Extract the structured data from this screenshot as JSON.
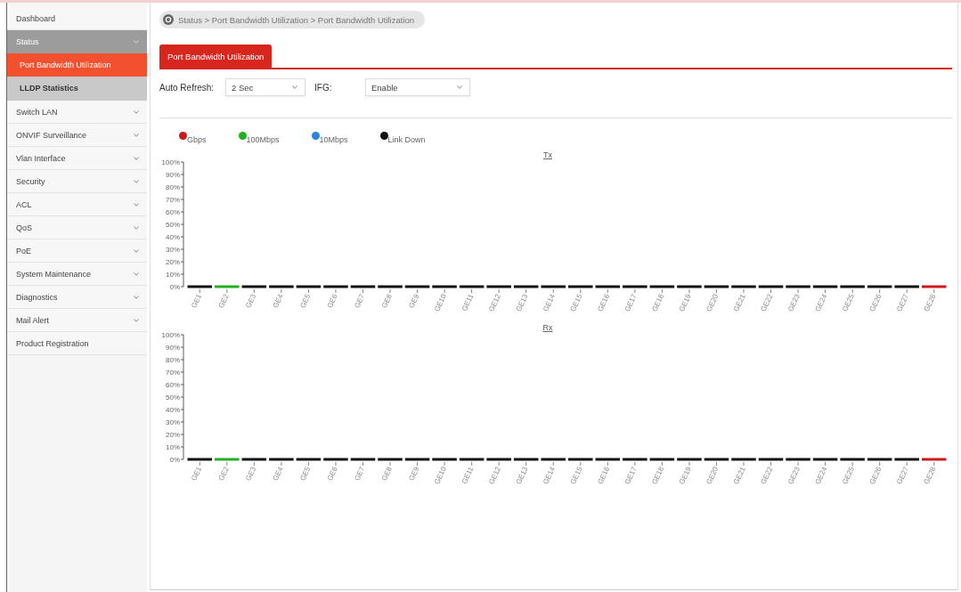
{
  "sidebar": {
    "items": [
      {
        "kind": "link",
        "label": "Dashboard"
      },
      {
        "kind": "group",
        "label": "Status",
        "expanded": true,
        "children": [
          {
            "label": "Port Bandwidth Utilization",
            "selected": true
          },
          {
            "label": "LLDP Statistics",
            "selected": false
          }
        ]
      },
      {
        "kind": "group",
        "label": "Switch LAN",
        "expanded": false
      },
      {
        "kind": "group",
        "label": "ONVIF Surveillance",
        "expanded": false
      },
      {
        "kind": "group",
        "label": "Vlan Interface",
        "expanded": false
      },
      {
        "kind": "group",
        "label": "Security",
        "expanded": false
      },
      {
        "kind": "group",
        "label": "ACL",
        "expanded": false
      },
      {
        "kind": "group",
        "label": "QoS",
        "expanded": false
      },
      {
        "kind": "group",
        "label": "PoE",
        "expanded": false
      },
      {
        "kind": "group",
        "label": "System Maintenance",
        "expanded": false
      },
      {
        "kind": "group",
        "label": "Diagnostics",
        "expanded": false
      },
      {
        "kind": "group",
        "label": "Mail Alert",
        "expanded": false
      },
      {
        "kind": "link",
        "label": "Product Registration"
      }
    ]
  },
  "breadcrumb": {
    "text": "Status > Port Bandwidth Utilization > Port Bandwidth Utilization"
  },
  "tabs": [
    {
      "label": "Port Bandwidth Utilization",
      "selected": true
    }
  ],
  "controls": [
    {
      "label": "Auto Refresh:",
      "value": "2 Sec"
    },
    {
      "label": "IFG:",
      "value": "Enable"
    }
  ],
  "charts": [
    {
      "chart_data": {
        "type": "bar",
        "title": "Tx",
        "categories": [
          "GE1",
          "GE2",
          "GE3",
          "GE4",
          "GE5",
          "GE6",
          "GE7",
          "GE8",
          "GE9",
          "GE10",
          "GE11",
          "GE12",
          "GE13",
          "GE14",
          "GE15",
          "GE16",
          "GE17",
          "GE18",
          "GE19",
          "GE20",
          "GE21",
          "GE22",
          "GE23",
          "GE24",
          "GE25",
          "GE26",
          "GE27",
          "GE28"
        ],
        "ylim": [
          0,
          100
        ],
        "yticks": [
          {
            "value": 0,
            "label": "0%"
          },
          {
            "value": 10,
            "label": "10%"
          },
          {
            "value": 20,
            "label": "20%"
          },
          {
            "value": 30,
            "label": "30%"
          },
          {
            "value": 40,
            "label": "40%"
          },
          {
            "value": 50,
            "label": "50%"
          },
          {
            "value": 60,
            "label": "60%"
          },
          {
            "value": 70,
            "label": "70%"
          },
          {
            "value": 80,
            "label": "80%"
          },
          {
            "value": 90,
            "label": "90%"
          },
          {
            "value": 100,
            "label": "100%"
          }
        ],
        "series": [
          {
            "name": "Gbps",
            "color": "#cc1a1a",
            "values": [
              null,
              null,
              null,
              null,
              null,
              null,
              null,
              null,
              null,
              null,
              null,
              null,
              null,
              null,
              null,
              null,
              null,
              null,
              null,
              null,
              null,
              null,
              null,
              null,
              null,
              null,
              null,
              0
            ]
          },
          {
            "name": "100Mbps",
            "color": "#22b022",
            "values": [
              null,
              0,
              null,
              null,
              null,
              null,
              null,
              null,
              null,
              null,
              null,
              null,
              null,
              null,
              null,
              null,
              null,
              null,
              null,
              null,
              null,
              null,
              null,
              null,
              null,
              null,
              null,
              null
            ]
          },
          {
            "name": "10Mbps",
            "color": "#2b86d8",
            "values": [
              null,
              null,
              null,
              null,
              null,
              null,
              null,
              null,
              null,
              null,
              null,
              null,
              null,
              null,
              null,
              null,
              null,
              null,
              null,
              null,
              null,
              null,
              null,
              null,
              null,
              null,
              null,
              null
            ]
          },
          {
            "name": "Link Down",
            "color": "#111111",
            "values": [
              0,
              null,
              0,
              0,
              0,
              0,
              0,
              0,
              0,
              0,
              0,
              0,
              0,
              0,
              0,
              0,
              0,
              0,
              0,
              0,
              0,
              0,
              0,
              0,
              0,
              0,
              0,
              null
            ]
          }
        ]
      }
    },
    {
      "chart_data": {
        "type": "bar",
        "title": "Rx",
        "categories": [
          "GE1",
          "GE2",
          "GE3",
          "GE4",
          "GE5",
          "GE6",
          "GE7",
          "GE8",
          "GE9",
          "GE10",
          "GE11",
          "GE12",
          "GE13",
          "GE14",
          "GE15",
          "GE16",
          "GE17",
          "GE18",
          "GE19",
          "GE20",
          "GE21",
          "GE22",
          "GE23",
          "GE24",
          "GE25",
          "GE26",
          "GE27",
          "GE28"
        ],
        "ylim": [
          0,
          100
        ],
        "yticks": [
          {
            "value": 0,
            "label": "0%"
          },
          {
            "value": 10,
            "label": "10%"
          },
          {
            "value": 20,
            "label": "20%"
          },
          {
            "value": 30,
            "label": "30%"
          },
          {
            "value": 40,
            "label": "40%"
          },
          {
            "value": 50,
            "label": "50%"
          },
          {
            "value": 60,
            "label": "60%"
          },
          {
            "value": 70,
            "label": "70%"
          },
          {
            "value": 80,
            "label": "80%"
          },
          {
            "value": 90,
            "label": "90%"
          },
          {
            "value": 100,
            "label": "100%"
          }
        ],
        "series": [
          {
            "color": "#cc1a1a",
            "values": [
              null,
              null,
              null,
              null,
              null,
              null,
              null,
              null,
              null,
              null,
              null,
              null,
              null,
              null,
              null,
              null,
              null,
              null,
              null,
              null,
              null,
              null,
              null,
              null,
              null,
              null,
              null,
              0
            ]
          },
          {
            "color": "#22b022",
            "values": [
              null,
              0,
              null,
              null,
              null,
              null,
              null,
              null,
              null,
              null,
              null,
              null,
              null,
              null,
              null,
              null,
              null,
              null,
              null,
              null,
              null,
              null,
              null,
              null,
              null,
              null,
              null,
              null
            ]
          },
          {
            "color": "#111111",
            "values": [
              0,
              null,
              0,
              0,
              0,
              0,
              0,
              0,
              0,
              0,
              0,
              0,
              0,
              0,
              0,
              0,
              0,
              0,
              0,
              0,
              0,
              0,
              0,
              0,
              0,
              0,
              0,
              null
            ]
          }
        ]
      }
    }
  ]
}
